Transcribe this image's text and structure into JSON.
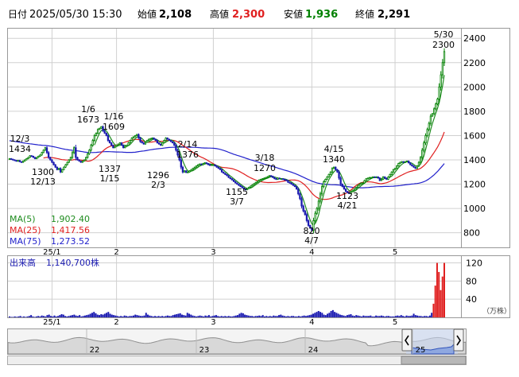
{
  "header": {
    "date_label": "日付",
    "datetime": "2025/05/30 15:30",
    "open_label": "始値",
    "open_value": "2,108",
    "high_label": "高値",
    "high_value": "2,300",
    "low_label": "安値",
    "low_value": "1,936",
    "close_label": "終値",
    "close_value": "2,291"
  },
  "colors": {
    "up": "#008000",
    "down": "#1a1ab0",
    "candle_up_fill": "#ffffff",
    "ma5": "#1e8c1e",
    "ma25": "#e02020",
    "ma75": "#2222cc",
    "volume": "#1a1ab0",
    "volume_recent": "#e02020",
    "high_value": "#e02020",
    "low_value": "#008000",
    "grid": "#d0d0d0"
  },
  "legend": [
    {
      "name": "MA(5)",
      "value": "1,902.40",
      "color": "#1e8c1e"
    },
    {
      "name": "MA(25)",
      "value": "1,417.56",
      "color": "#e02020"
    },
    {
      "name": "MA(75)",
      "value": "1,273.52",
      "color": "#2222cc"
    }
  ],
  "volume_label": {
    "title": "出来高",
    "value": "1,140,700株"
  },
  "volume_unit": "（万株）",
  "price_ticks": [
    "2400",
    "2200",
    "2000",
    "1800",
    "1600",
    "1400",
    "1200",
    "1000",
    "800"
  ],
  "volume_ticks": [
    "120",
    "80",
    "40"
  ],
  "month_ticks": [
    "25/1",
    "2",
    "3",
    "4",
    "5"
  ],
  "navigator_ticks": [
    "22",
    "23",
    "24",
    "25"
  ],
  "annotations": [
    {
      "date": "12/3",
      "value": "1434"
    },
    {
      "date": "12/13",
      "value": "1300"
    },
    {
      "date": "1/6",
      "value": "1673"
    },
    {
      "date": "1/16",
      "value": "1609"
    },
    {
      "date": "1/15",
      "value": "1337"
    },
    {
      "date": "2/3",
      "value": "1296"
    },
    {
      "date": "2/14",
      "value": "1376"
    },
    {
      "date": "3/7",
      "value": "1155"
    },
    {
      "date": "3/18",
      "value": "1270"
    },
    {
      "date": "4/15",
      "value": "1340"
    },
    {
      "date": "4/7",
      "value": "820"
    },
    {
      "date": "4/21",
      "value": "1123"
    },
    {
      "date": "5/30",
      "value": "2300"
    }
  ],
  "chart_data": {
    "type": "candlestick",
    "x_ticks": [
      "25/1",
      "2",
      "3",
      "4",
      "5"
    ],
    "y_ticks": [
      2400,
      2200,
      2000,
      1800,
      1600,
      1400,
      1200,
      1000,
      800
    ],
    "ylim": [
      680,
      2480
    ],
    "close_series": [
      [
        1410,
        1405,
        1400,
        1395,
        1390,
        1395,
        1385,
        1380,
        1390,
        1400,
        1410,
        1420,
        1434,
        1430,
        1420,
        1410,
        1420,
        1430,
        1440,
        1460,
        1480,
        1500,
        1460,
        1420,
        1400,
        1380,
        1360,
        1340,
        1320,
        1330,
        1300,
        1320,
        1340,
        1360,
        1380,
        1400,
        1420,
        1460,
        1500,
        1420,
        1400,
        1390,
        1380,
        1390,
        1400,
        1420,
        1450,
        1480,
        1520,
        1560,
        1600,
        1620,
        1650,
        1660,
        1673,
        1640,
        1620,
        1600,
        1560,
        1540,
        1520,
        1500,
        1510,
        1520,
        1530,
        1540,
        1520,
        1500,
        1510,
        1520,
        1540,
        1560,
        1580,
        1590,
        1600,
        1609,
        1580,
        1550,
        1540,
        1530,
        1545,
        1560,
        1570,
        1575,
        1580,
        1570,
        1560,
        1540,
        1530,
        1520,
        1540,
        1560,
        1580,
        1570,
        1560,
        1550,
        1540,
        1520,
        1480,
        1440,
        1400,
        1340,
        1300,
        1310,
        1296,
        1300,
        1310,
        1320,
        1330,
        1340,
        1350,
        1360,
        1366,
        1360,
        1370,
        1376,
        1370,
        1360,
        1355,
        1360,
        1360,
        1350,
        1340,
        1330,
        1320,
        1300,
        1290,
        1280,
        1270,
        1255,
        1245,
        1235,
        1222,
        1210,
        1200,
        1190,
        1180,
        1170,
        1160,
        1155,
        1165,
        1175,
        1185,
        1195,
        1205,
        1215,
        1225,
        1235,
        1240,
        1245,
        1250,
        1255,
        1262,
        1270,
        1265,
        1255,
        1245,
        1240,
        1250,
        1245,
        1245,
        1240,
        1235,
        1230,
        1215,
        1210,
        1200,
        1190,
        1180,
        1160,
        1120,
        1080,
        1020,
        980,
        950,
        900,
        860,
        840,
        820,
        900,
        960,
        1000,
        1060,
        1120,
        1180,
        1220,
        1240,
        1260,
        1280,
        1300,
        1330,
        1340,
        1320,
        1300,
        1250,
        1200,
        1180,
        1160,
        1140,
        1130,
        1123,
        1140,
        1150,
        1160,
        1175,
        1190,
        1200,
        1210,
        1210,
        1230,
        1245,
        1250,
        1255,
        1255,
        1260,
        1255,
        1260,
        1250,
        1230,
        1240,
        1260,
        1250,
        1240,
        1260,
        1280,
        1300,
        1320,
        1330,
        1350,
        1370,
        1380,
        1385,
        1380,
        1385,
        1390,
        1375,
        1360,
        1350,
        1340,
        1330,
        1350,
        1380,
        1420,
        1480,
        1540,
        1600,
        1650,
        1700,
        1760,
        1780,
        1820,
        1860,
        1900,
        2000,
        2100,
        2200,
        2291
      ]
    ],
    "ma5": {
      "name": "MA(5)",
      "last": 1902.4
    },
    "ma25": {
      "name": "MA(25)",
      "last": 1417.56
    },
    "ma75": {
      "name": "MA(75)",
      "last": 1273.52
    },
    "volume": {
      "unit": "万株",
      "ylim": [
        0,
        135
      ],
      "last": 1140700,
      "values": [
        2,
        1,
        1,
        2,
        1,
        2,
        3,
        1,
        2,
        1,
        2,
        3,
        5,
        2,
        1,
        2,
        3,
        2,
        4,
        3,
        2,
        5,
        6,
        3,
        2,
        4,
        2,
        3,
        5,
        7,
        6,
        3,
        2,
        3,
        4,
        5,
        6,
        4,
        3,
        5,
        2,
        3,
        4,
        5,
        6,
        8,
        10,
        12,
        9,
        6,
        5,
        7,
        6,
        8,
        10,
        12,
        8,
        6,
        5,
        4,
        3,
        2,
        3,
        2,
        4,
        3,
        2,
        3,
        3,
        4,
        6,
        5,
        4,
        3,
        3,
        4,
        10,
        6,
        4,
        3,
        2,
        3,
        2,
        3,
        2,
        3,
        2,
        3,
        4,
        3,
        3,
        5,
        6,
        7,
        8,
        9,
        6,
        5,
        4,
        10,
        8,
        6,
        4,
        3,
        2,
        3,
        4,
        3,
        2,
        4,
        3,
        5,
        2,
        3,
        4,
        5,
        3,
        2,
        3,
        2,
        3,
        2,
        3,
        2,
        2,
        3,
        4,
        5,
        8,
        10,
        9,
        6,
        5,
        4,
        3,
        3,
        2,
        3,
        3,
        4,
        3,
        5,
        2,
        3,
        2,
        3,
        2,
        4,
        3,
        3,
        5,
        6,
        4,
        3,
        2,
        3,
        2,
        3,
        3,
        2,
        2,
        3,
        2,
        3,
        4,
        3,
        4,
        5,
        6,
        8,
        10,
        12,
        14,
        12,
        10,
        6,
        5,
        8,
        10,
        14,
        16,
        12,
        10,
        8,
        6,
        5,
        4,
        3,
        5,
        6,
        7,
        4,
        3,
        5,
        4,
        3,
        2,
        4,
        3,
        3,
        3,
        4,
        2,
        2,
        4,
        3,
        3,
        4,
        3,
        2,
        3,
        3,
        2,
        2,
        2,
        3,
        4,
        3,
        5,
        3,
        2,
        4,
        3,
        3,
        4,
        8,
        5,
        4,
        3,
        3,
        2,
        3,
        3,
        2,
        4,
        10,
        30,
        70,
        120,
        100,
        60,
        90,
        120
      ]
    }
  }
}
